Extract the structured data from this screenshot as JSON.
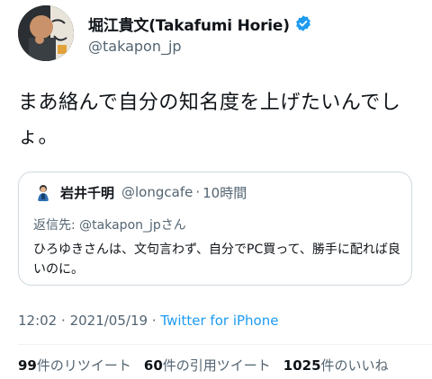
{
  "author": {
    "display_name": "堀江貴文(Takafumi Horie)",
    "handle": "@takapon_jp",
    "verified": true
  },
  "tweet": {
    "text": "まあ絡んで自分の知名度を上げたいんでしょ。"
  },
  "quoted_tweet": {
    "name": "岩井千明",
    "handle": "@longcafe",
    "separator": "·",
    "time": "10時間",
    "reply_prefix": "返信先: ",
    "reply_mention": "@takapon_jp",
    "reply_suffix": "さん",
    "text": "ひろゆきさんは、文句言わず、自分でPC買って、勝手に配れば良いのに。"
  },
  "meta": {
    "time": "12:02",
    "separator": "·",
    "date": "2021/05/19",
    "separator2": "·",
    "source": "Twitter for iPhone"
  },
  "stats": {
    "retweets_count": "99",
    "retweets_label": "件のリツイート",
    "quotes_count": "60",
    "quotes_label": "件の引用ツイート",
    "likes_count": "1025",
    "likes_label": "件のいいね"
  },
  "colors": {
    "accent": "#1d9bf0",
    "text": "#0f1419",
    "secondary": "#536471",
    "border": "#cfd9de"
  }
}
